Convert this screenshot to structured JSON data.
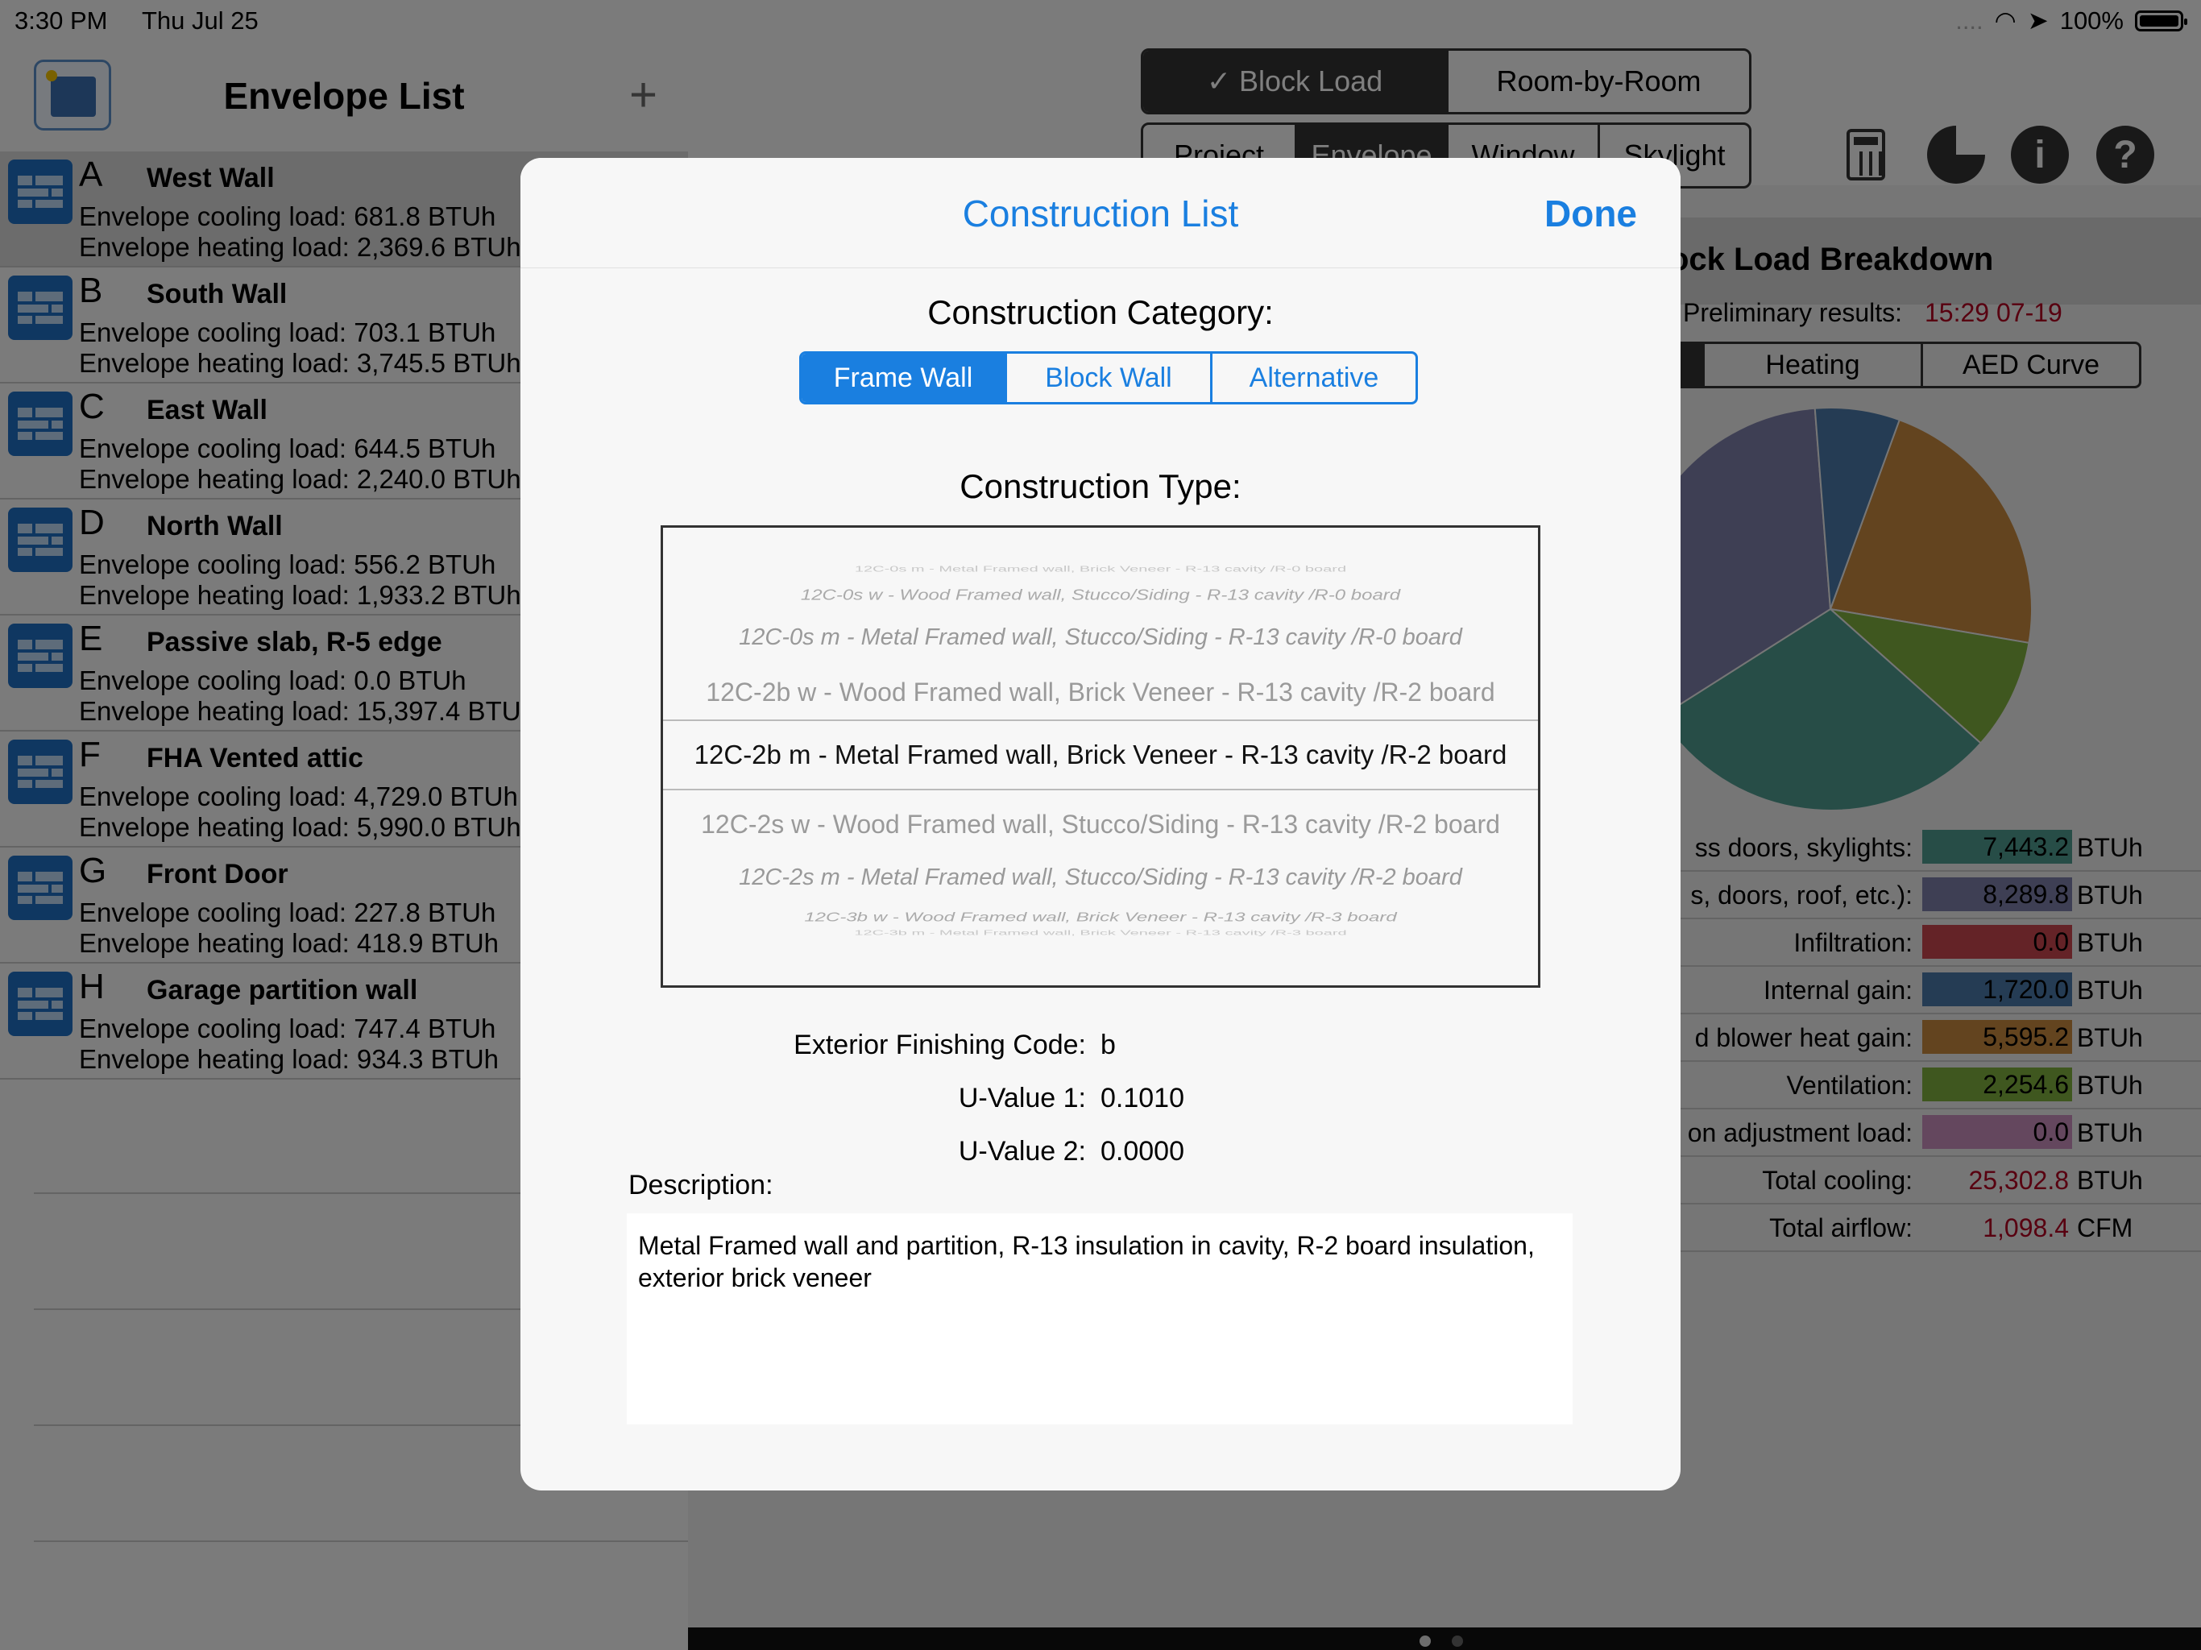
{
  "status_bar": {
    "time": "3:30 PM",
    "date": "Thu Jul 25",
    "signal": "....",
    "battery_text": "100%"
  },
  "left_panel": {
    "title": "Envelope List",
    "add_label": "+",
    "items": [
      {
        "letter": "A",
        "name": "West Wall",
        "cooling": "Envelope cooling load: 681.8 BTUh",
        "heating": "Envelope heating load: 2,369.6 BTUh",
        "selected": true
      },
      {
        "letter": "B",
        "name": "South Wall",
        "cooling": "Envelope cooling load: 703.1 BTUh",
        "heating": "Envelope heating load: 3,745.5 BTUh"
      },
      {
        "letter": "C",
        "name": "East Wall",
        "cooling": "Envelope cooling load: 644.5 BTUh",
        "heating": "Envelope heating load: 2,240.0 BTUh"
      },
      {
        "letter": "D",
        "name": "North Wall",
        "cooling": "Envelope cooling load: 556.2 BTUh",
        "heating": "Envelope heating load: 1,933.2 BTUh"
      },
      {
        "letter": "E",
        "name": "Passive slab, R-5 edge",
        "cooling": "Envelope cooling load: 0.0 BTUh",
        "heating": "Envelope heating load: 15,397.4 BTUh"
      },
      {
        "letter": "F",
        "name": "FHA Vented attic",
        "cooling": "Envelope cooling load: 4,729.0 BTUh",
        "heating": "Envelope heating load: 5,990.0 BTUh"
      },
      {
        "letter": "G",
        "name": "Front Door",
        "cooling": "Envelope cooling load: 227.8 BTUh",
        "heating": "Envelope heating load: 418.9 BTUh"
      },
      {
        "letter": "H",
        "name": "Garage partition wall",
        "cooling": "Envelope cooling load: 747.4 BTUh",
        "heating": "Envelope heating load: 934.3 BTUh"
      }
    ]
  },
  "right_panel": {
    "mode_tabs": [
      "✓ Block Load",
      "Room-by-Room"
    ],
    "section_tabs": [
      "Project",
      "Envelope",
      "Window",
      "Skylight"
    ],
    "icons": {
      "calculator": "calculator-icon",
      "pie": "pie-chart-icon",
      "info": "i",
      "help": "?"
    },
    "breakdown_title": "ock Load Breakdown",
    "prelim_label": "Preliminary results:",
    "prelim_time": "15:29 07-19",
    "chart_tabs": [
      "Heating",
      "AED Curve"
    ],
    "legend": [
      {
        "label": "ss doors, skylights:",
        "value": "7,443.2",
        "unit": "BTUh",
        "color": "#4f9a8f"
      },
      {
        "label": "s, doors, roof, etc.):",
        "value": "8,289.8",
        "unit": "BTUh",
        "color": "#7d7fa8"
      },
      {
        "label": "Infiltration:",
        "value": "0.0",
        "unit": "BTUh",
        "color": "#c9474f"
      },
      {
        "label": "Internal gain:",
        "value": "1,720.0",
        "unit": "BTUh",
        "color": "#4a78a8"
      },
      {
        "label": "d blower heat gain:",
        "value": "5,595.2",
        "unit": "BTUh",
        "color": "#c6883f"
      },
      {
        "label": "Ventilation:",
        "value": "2,254.6",
        "unit": "BTUh",
        "color": "#7fae3e"
      },
      {
        "label": "on adjustment load:",
        "value": "0.0",
        "unit": "BTUh",
        "color": "#c98fbc"
      },
      {
        "label": "Total cooling:",
        "value": "25,302.8",
        "unit": "BTUh",
        "color": ""
      },
      {
        "label": "Total airflow:",
        "value": "1,098.4",
        "unit": "CFM",
        "color": ""
      }
    ]
  },
  "modal": {
    "title": "Construction List",
    "done": "Done",
    "category_label": "Construction Category:",
    "categories": [
      "Frame Wall",
      "Block Wall",
      "Alternative"
    ],
    "active_category": 0,
    "type_label": "Construction Type:",
    "picker_items": [
      "12C-0s m - Metal Framed wall, Brick Veneer - R-13 cavity /R-0 board",
      "12C-0s w - Wood Framed wall, Stucco/Siding - R-13 cavity /R-0 board",
      "12C-0s m - Metal Framed wall, Stucco/Siding - R-13 cavity /R-0 board",
      "12C-2b w - Wood Framed wall, Brick Veneer - R-13 cavity /R-2 board",
      "12C-2b m - Metal Framed wall, Brick Veneer - R-13 cavity /R-2 board",
      "12C-2s w - Wood Framed wall, Stucco/Siding - R-13 cavity /R-2 board",
      "12C-2s m - Metal Framed wall, Stucco/Siding - R-13 cavity /R-2 board",
      "12C-3b w - Wood Framed wall, Brick Veneer - R-13 cavity /R-3 board",
      "12C-3b m - Metal Framed wall, Brick Veneer - R-13 cavity /R-3 board"
    ],
    "selected_index": 4,
    "properties": [
      {
        "label": "Exterior Finishing Code:",
        "value": "b"
      },
      {
        "label": "U-Value 1:",
        "value": "0.1010"
      },
      {
        "label": "U-Value 2:",
        "value": "0.0000"
      }
    ],
    "description_label": "Description:",
    "description": "Metal Framed wall and partition, R-13 insulation in cavity, R-2 board insulation, exterior brick veneer"
  },
  "chart_data": {
    "type": "pie",
    "categories": [
      "ss doors, skylights",
      "s, doors, roof, etc.)",
      "Infiltration",
      "Internal gain",
      "d blower heat gain",
      "Ventilation",
      "on adjustment load"
    ],
    "values": [
      7443.2,
      8289.8,
      0.0,
      1720.0,
      5595.2,
      2254.6,
      0.0
    ],
    "colors": [
      "#4f9a8f",
      "#7d7fa8",
      "#c9474f",
      "#4a78a8",
      "#c6883f",
      "#7fae3e",
      "#c98fbc"
    ]
  }
}
